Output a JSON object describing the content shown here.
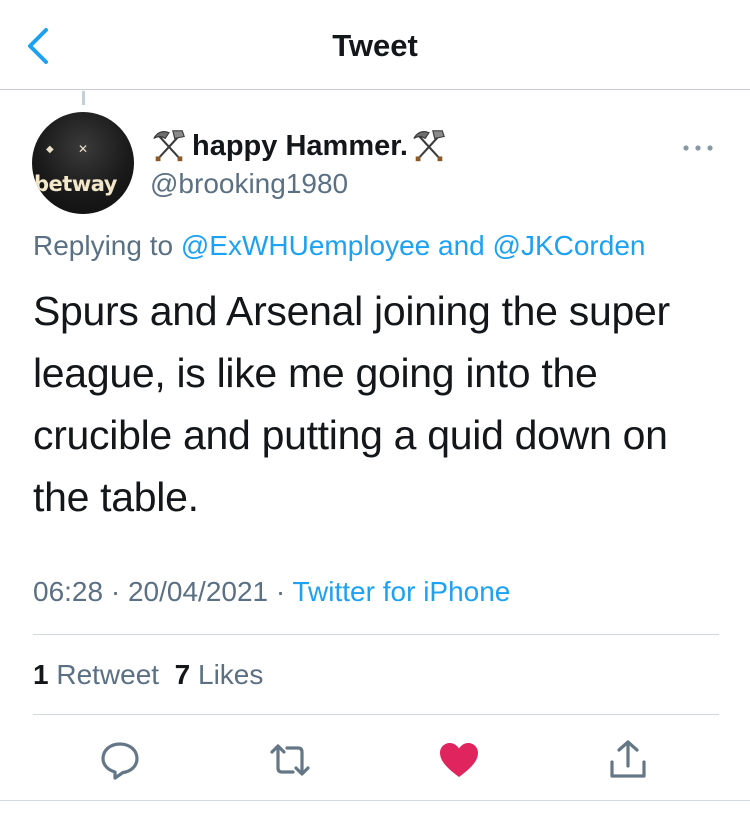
{
  "nav": {
    "title": "Tweet",
    "back_icon": "chevron-left-icon"
  },
  "author": {
    "name_prefix_icon": "hammer-pick-icon",
    "name": "happy Hammer.",
    "name_suffix_icon": "hammer-pick-icon",
    "handle": "@brooking1980",
    "avatar_text": "betway"
  },
  "reply": {
    "prefix": "Replying to ",
    "mention1": "@ExWHUemployee",
    "joiner": " and ",
    "mention2": "@JKCorden"
  },
  "tweet": {
    "text": "Spurs and Arsenal joining the super league, is like me going into the crucible and putting a quid down on the table."
  },
  "meta": {
    "time": "06:28",
    "dot1": " · ",
    "date": "20/04/2021",
    "dot2": " · ",
    "source": "Twitter for iPhone"
  },
  "stats": {
    "retweets_count": "1",
    "retweets_label": "Retweet",
    "likes_count": "7",
    "likes_label": "Likes"
  },
  "actions": {
    "reply_icon": "reply-bubble-icon",
    "retweet_icon": "retweet-icon",
    "like_icon": "heart-icon",
    "share_icon": "share-icon",
    "like_color": "#e0245e",
    "icon_color": "#657786"
  },
  "colors": {
    "accent": "#1da1f2",
    "secondary_text": "#5b7083",
    "primary_text": "#14171a"
  }
}
